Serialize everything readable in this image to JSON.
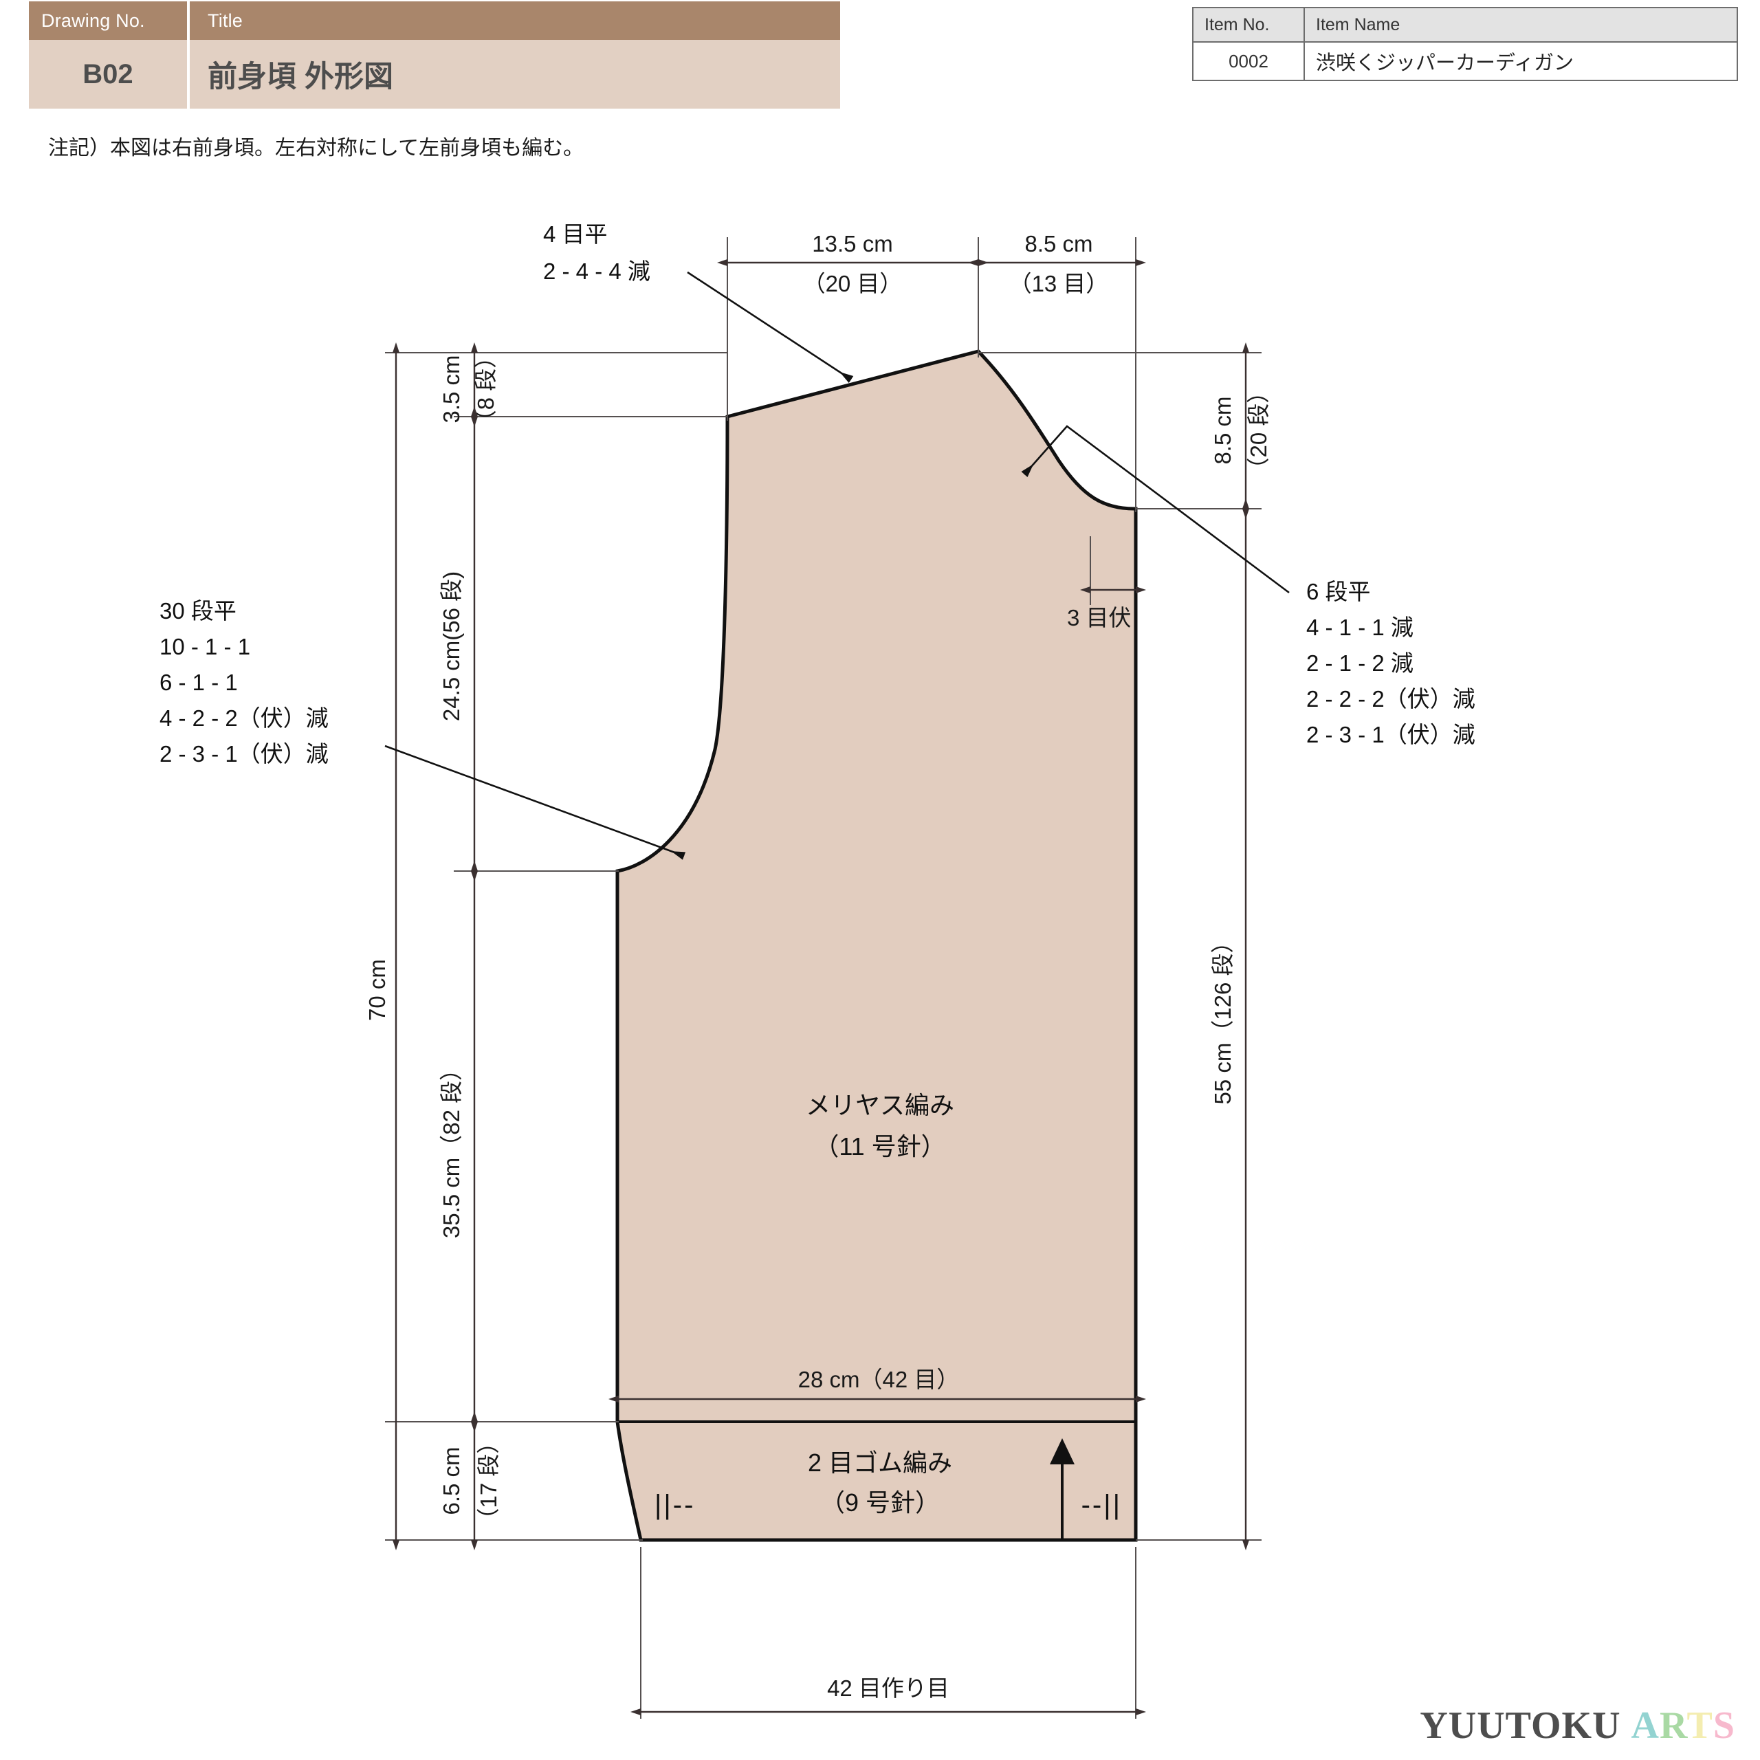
{
  "title_block": {
    "head_drawing_no": "Drawing No.",
    "head_title": "Title",
    "drawing_no": "B02",
    "title": "前身頃  外形図"
  },
  "item_table": {
    "head_item_no": "Item No.",
    "head_item_name": "Item Name",
    "item_no": "0002",
    "item_name": "渋咲くジッパーカーディガン"
  },
  "note": "注記）本図は右前身頃。左右対称にして左前身頃も編む。",
  "watermark": {
    "dark": "YUUTOKU",
    "a": "A",
    "r": "R",
    "t": "T",
    "s": "S"
  },
  "chart_data": {
    "type": "diagram",
    "title": "前身頃  外形図",
    "piece": "右前身頃",
    "body_stitch": "メリヤス編み",
    "body_needle": "（11 号針）",
    "rib_stitch": "2 目ゴム編み",
    "rib_needle": "（9 号針）",
    "cast_on": "42 目作り目",
    "horizontal_dims": [
      {
        "label": "13.5 cm",
        "sub": "（20 目）",
        "cm": 13.5,
        "stitches": 20
      },
      {
        "label": "8.5 cm",
        "sub": "（13 目）",
        "cm": 8.5,
        "stitches": 13
      },
      {
        "label": "28 cm（42 目）",
        "cm": 28,
        "stitches": 42
      },
      {
        "label": "3 目伏",
        "stitches": 3
      }
    ],
    "vertical_dims": [
      {
        "label": "70 cm",
        "cm": 70
      },
      {
        "label": "3.5 cm",
        "sub": "（8 段）",
        "cm": 3.5,
        "rows": 8
      },
      {
        "label": "24.5 cm(56 段)",
        "cm": 24.5,
        "rows": 56
      },
      {
        "label": "35.5 cm（82 段）",
        "cm": 35.5,
        "rows": 82
      },
      {
        "label": "6.5 cm",
        "sub": "（17 段）",
        "cm": 6.5,
        "rows": 17
      },
      {
        "label": "8.5 cm",
        "sub": "（20 段）",
        "cm": 8.5,
        "rows": 20
      },
      {
        "label": "55 cm（126 段）",
        "cm": 55,
        "rows": 126
      }
    ],
    "callouts": {
      "neckline": {
        "lines": [
          "4 目平",
          "2 - 4 - 4 減"
        ]
      },
      "armhole_left": {
        "lines": [
          "30 段平",
          "10 - 1 - 1",
          "6 - 1 - 1",
          "4 - 2 - 2（伏）減",
          "2 - 3 - 1（伏）減"
        ]
      },
      "armhole_right": {
        "lines": [
          "6 段平",
          "4 - 1 - 1 減",
          "2 - 1 - 2 減",
          "2 - 2 - 2（伏）減",
          "2 - 3 - 1（伏）減"
        ]
      },
      "shoulder_bind": {
        "lines": [
          "3 目伏"
        ]
      }
    },
    "rib_marks": {
      "left": "||--",
      "right": "--||"
    }
  },
  "labels": {
    "dim_135_cm": "13.5 cm",
    "dim_135_st": "（20 目）",
    "dim_85_cm": "8.5 cm",
    "dim_85_st": "（13 目）",
    "dim_70cm": "70 cm",
    "dim_35cm": "3.5 cm",
    "dim_35cm_rows": "（8 段）",
    "dim_245": "24.5 cm(56 段)",
    "dim_355": "35.5 cm（82 段）",
    "dim_65cm": "6.5 cm",
    "dim_65cm_rows": "（17 段）",
    "dim_85v_cm": "8.5 cm",
    "dim_85v_rows": "（20 段）",
    "dim_55": "55 cm（126 段）",
    "dim_28": "28 cm（42 目）",
    "bind3": "3 目伏",
    "cast_on": "42 目作り目",
    "neck_l1": "4 目平",
    "neck_l2": "2 - 4 - 4 減",
    "left_l1": "30 段平",
    "left_l2": "10 - 1 - 1",
    "left_l3": "6 - 1 - 1",
    "left_l4": "4 - 2 - 2（伏）減",
    "left_l5": "2 - 3 - 1（伏）減",
    "right_l1": "6 段平",
    "right_l2": "4 - 1 - 1 減",
    "right_l3": "2 - 1 - 2 減",
    "right_l4": "2 - 2 - 2（伏）減",
    "right_l5": "2 - 3 - 1（伏）減",
    "body_stitch": "メリヤス編み",
    "body_needle": "（11 号針）",
    "rib_stitch": "2 目ゴム編み",
    "rib_needle": "（9 号針）",
    "rib_mark_left": "||--",
    "rib_mark_right": "--||"
  }
}
